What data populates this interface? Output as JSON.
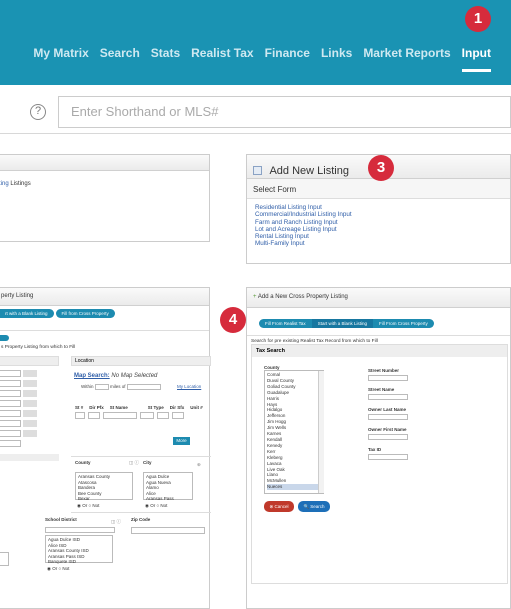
{
  "nav": {
    "items": [
      "My Matrix",
      "Search",
      "Stats",
      "Realist Tax",
      "Finance",
      "Links",
      "Market Reports",
      "Input"
    ],
    "active": "Input"
  },
  "badges": [
    "1",
    "3",
    "4"
  ],
  "search": {
    "placeholder": "Enter Shorthand or MLS#",
    "help": "?"
  },
  "left_top": {
    "text_prefix": "ting",
    "text_suffix": "Listings"
  },
  "add_listing": {
    "title": "Add New Listing",
    "subtitle": "Select Form",
    "links": [
      "Residential Listing Input",
      "Commercial/Industrial Listing Input",
      "Farm and Ranch Listing Input",
      "Lot and Acreage Listing Input",
      "Rental Listing Input",
      "Multi-Family Input"
    ]
  },
  "left_bottom": {
    "title": "perty Listing",
    "pill1": "rt with a Blank Listing",
    "pill2": "Fill from Cross Property",
    "subline": "s Property Listing from which to Fill",
    "location": "Location",
    "map_search": "Map Search:",
    "map_selected": "No Map Selected",
    "within": "Within",
    "miles_of": "miles of",
    "my_location": "My Location",
    "street_cols": [
      "St #",
      "Dir Pfx",
      "St Name",
      "St Type",
      "Dir Sfx",
      "Unit #"
    ],
    "more": "More",
    "county_label": "County",
    "county_list": [
      "Aransas County",
      "Atascosa",
      "Bandera",
      "Bee County",
      "Bexar"
    ],
    "city_label": "City",
    "city_list": [
      "Agua Dulce",
      "Agua Nueva",
      "Alamo",
      "Alice",
      "Aransas Pass"
    ],
    "or": "Or",
    "not": "Not",
    "school_label": "School District",
    "school_list": [
      "Agua Dulce ISD",
      "Alice ISD",
      "Aransas County ISD",
      "Aransas Pass ISD",
      "Banquete ISD"
    ],
    "zip_label": "Zip Code"
  },
  "right_bottom": {
    "title": "Add a New Cross Property Listing",
    "pill1": "Fill From Realist Tax",
    "pill2": "Start with a Blank Listing",
    "pill3": "Fill From Cross Property",
    "subline": "Search for pre existing Realist Tax Record from which to Fill",
    "tax_search": "Tax Search",
    "county_label": "County",
    "counties": [
      "Comal",
      "Duval County",
      "Goliad County",
      "Guadalupe",
      "Harris",
      "Hays",
      "Hidalgo",
      "Jefferson",
      "Jim Hogg",
      "Jim Wells",
      "Karnes",
      "Kendall",
      "Kenedy",
      "Kerr",
      "Kleberg",
      "Lavaca",
      "Live Oak",
      "Llano",
      "McMullen",
      "Nueces"
    ],
    "fields": [
      "Street Number",
      "Street Name",
      "Owner Last Name",
      "Owner First Name",
      "Tax ID"
    ],
    "cancel": "Cancel",
    "search": "Search"
  },
  "colors": {
    "topbar": "#1a93b3",
    "badge": "#d62b3c",
    "link": "#2f5ea8"
  }
}
